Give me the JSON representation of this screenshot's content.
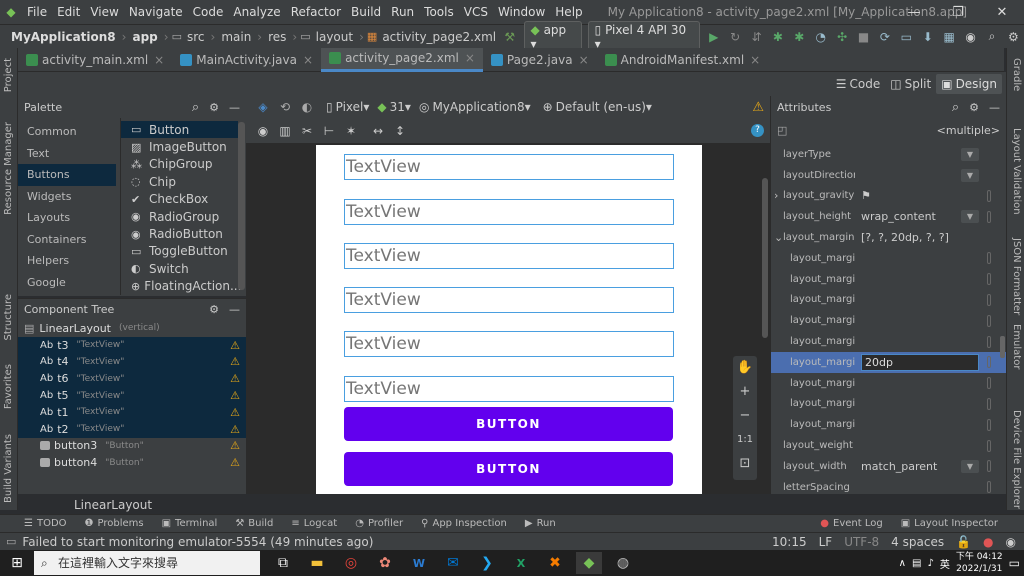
{
  "menu": [
    "File",
    "Edit",
    "View",
    "Navigate",
    "Code",
    "Analyze",
    "Refactor",
    "Build",
    "Run",
    "Tools",
    "VCS",
    "Window",
    "Help"
  ],
  "window_title": "My Application8 - activity_page2.xml [My_Application8.app]",
  "window_controls": [
    "—",
    "❐",
    "✕"
  ],
  "breadcrumb": [
    "MyApplication8",
    "app",
    "src",
    "main",
    "res",
    "layout",
    "activity_page2.xml"
  ],
  "run_config": "app",
  "device": "Pixel 4 API 30",
  "tabs": [
    {
      "label": "activity_main.xml",
      "color": "#3b8e4f"
    },
    {
      "label": "MainActivity.java",
      "color": "#3592c4"
    },
    {
      "label": "activity_page2.xml",
      "color": "#3b8e4f",
      "active": true
    },
    {
      "label": "Page2.java",
      "color": "#3592c4"
    },
    {
      "label": "AndroidManifest.xml",
      "color": "#3b8e4f"
    }
  ],
  "view_modes": [
    "Code",
    "Split",
    "Design"
  ],
  "palette": {
    "title": "Palette",
    "categories": [
      "Common",
      "Text",
      "Buttons",
      "Widgets",
      "Layouts",
      "Containers",
      "Helpers",
      "Google"
    ],
    "selected_category": "Buttons",
    "items": [
      "Button",
      "ImageButton",
      "ChipGroup",
      "Chip",
      "CheckBox",
      "RadioGroup",
      "RadioButton",
      "ToggleButton",
      "Switch",
      "FloatingAction..."
    ]
  },
  "component_tree": {
    "title": "Component Tree",
    "root": "LinearLayout",
    "root_sub": "(vertical)",
    "nodes": [
      {
        "prefix": "Ab",
        "name": "t3",
        "sub": "\"TextView\"",
        "sel": true
      },
      {
        "prefix": "Ab",
        "name": "t4",
        "sub": "\"TextView\"",
        "sel": true
      },
      {
        "prefix": "Ab",
        "name": "t6",
        "sub": "\"TextView\"",
        "sel": true
      },
      {
        "prefix": "Ab",
        "name": "t5",
        "sub": "\"TextView\"",
        "sel": true
      },
      {
        "prefix": "Ab",
        "name": "t1",
        "sub": "\"TextView\"",
        "sel": true
      },
      {
        "prefix": "Ab",
        "name": "t2",
        "sub": "\"TextView\"",
        "sel": true
      },
      {
        "prefix": "",
        "name": "button3",
        "sub": "\"Button\"",
        "sel": false
      },
      {
        "prefix": "",
        "name": "button4",
        "sub": "\"Button\"",
        "sel": false
      }
    ],
    "footer": "LinearLayout"
  },
  "design_toolbar": {
    "device": "Pixel",
    "api": "31",
    "theme": "MyApplication8",
    "locale": "Default (en-us)"
  },
  "canvas": {
    "textviews": [
      "TextView",
      "TextView",
      "TextView",
      "TextView",
      "TextView",
      "TextView"
    ],
    "buttons": [
      "BUTTON",
      "BUTTON"
    ]
  },
  "zoom_controls": [
    "✋",
    "+",
    "−",
    "1:1",
    "⊡"
  ],
  "attributes": {
    "title": "Attributes",
    "selection": "<multiple>",
    "rows": [
      {
        "name": "layerType",
        "value": "",
        "dd": true
      },
      {
        "name": "layoutDirection",
        "value": "",
        "dd": true
      },
      {
        "name": "layout_gravity",
        "value": "⚑",
        "expand": "›",
        "pin": true
      },
      {
        "name": "layout_height",
        "value": "wrap_content",
        "dd": true,
        "pin": true
      },
      {
        "name": "layout_margin",
        "value": "[?, ?, 20dp, ?, ?]",
        "expand": "⌄"
      },
      {
        "name": "layout_margin",
        "value": "",
        "indent": true,
        "pin": true
      },
      {
        "name": "layout_margin...",
        "value": "",
        "indent": true,
        "pin": true
      },
      {
        "name": "layout_margin...",
        "value": "",
        "indent": true,
        "pin": true
      },
      {
        "name": "layout_margin...",
        "value": "",
        "indent": true,
        "pin": true
      },
      {
        "name": "layout_margin...",
        "value": "",
        "indent": true,
        "pin": true
      },
      {
        "name": "layout_margin...",
        "value": "20dp",
        "indent": true,
        "selected": true,
        "pin": true
      },
      {
        "name": "layout_margin...",
        "value": "",
        "indent": true,
        "pin": true
      },
      {
        "name": "layout_margin...",
        "value": "",
        "indent": true,
        "pin": true
      },
      {
        "name": "layout_margin...",
        "value": "",
        "indent": true,
        "pin": true
      },
      {
        "name": "layout_weight",
        "value": "",
        "pin": true
      },
      {
        "name": "layout_width",
        "value": "match_parent",
        "dd": true,
        "pin": true
      },
      {
        "name": "letterSpacing",
        "value": "",
        "pin": true
      }
    ]
  },
  "left_strip": [
    "Project",
    "Resource Manager",
    "Structure",
    "Favorites",
    "Build Variants"
  ],
  "right_strip": [
    "Gradle",
    "Layout Validation",
    "JSON Formatter",
    "Emulator",
    "Device File Explorer"
  ],
  "bottom_tabs": [
    {
      "icon": "☰",
      "label": "TODO"
    },
    {
      "icon": "❶",
      "label": "Problems"
    },
    {
      "icon": "▣",
      "label": "Terminal"
    },
    {
      "icon": "⚒",
      "label": "Build"
    },
    {
      "icon": "≡",
      "label": "Logcat"
    },
    {
      "icon": "◔",
      "label": "Profiler"
    },
    {
      "icon": "⚲",
      "label": "App Inspection"
    },
    {
      "icon": "▶",
      "label": "Run"
    }
  ],
  "bottom_right_tabs": [
    {
      "icon": "●",
      "label": "Event Log"
    },
    {
      "icon": "▣",
      "label": "Layout Inspector"
    }
  ],
  "status": {
    "message": "Failed to start monitoring emulator-5554 (49 minutes ago)",
    "position": "10:15",
    "line_sep": "LF",
    "encoding": "UTF-8",
    "indent": "4 spaces"
  },
  "taskbar": {
    "search_placeholder": "在這裡輸入文字來搜尋",
    "time": "下午 04:12",
    "date": "2022/1/31",
    "ime": "英"
  },
  "colors": {
    "accent": "#4a88c7",
    "button": "#6200ee",
    "selection": "#0d293e",
    "warning": "#e6a817"
  }
}
